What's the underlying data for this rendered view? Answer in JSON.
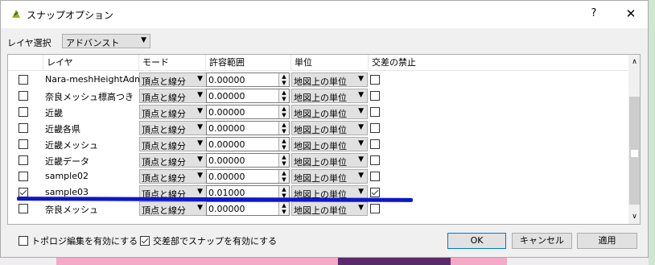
{
  "dialog": {
    "title": "スナップオプション",
    "help": "?",
    "close": "✕"
  },
  "layer_select": {
    "label": "レイヤ選択",
    "value": "アドバンスト"
  },
  "table": {
    "headers": [
      "レイヤ",
      "モード",
      "許容範囲",
      "単位",
      "交差の禁止"
    ],
    "rows": [
      {
        "checked": false,
        "name": "Nara-meshHeightAdm",
        "mode": "頂点と線分",
        "tolerance": "0.00000",
        "unit": "地図上の単位",
        "avoid": false
      },
      {
        "checked": false,
        "name": "奈良メッシュ標高つき",
        "mode": "頂点と線分",
        "tolerance": "0.00000",
        "unit": "地図上の単位",
        "avoid": false
      },
      {
        "checked": false,
        "name": "近畿",
        "mode": "頂点と線分",
        "tolerance": "0.00000",
        "unit": "地図上の単位",
        "avoid": false
      },
      {
        "checked": false,
        "name": "近畿各県",
        "mode": "頂点と線分",
        "tolerance": "0.00000",
        "unit": "地図上の単位",
        "avoid": false
      },
      {
        "checked": false,
        "name": "近畿メッシュ",
        "mode": "頂点と線分",
        "tolerance": "0.00000",
        "unit": "地図上の単位",
        "avoid": false
      },
      {
        "checked": false,
        "name": "近畿データ",
        "mode": "頂点と線分",
        "tolerance": "0.00000",
        "unit": "地図上の単位",
        "avoid": false
      },
      {
        "checked": false,
        "name": "sample02",
        "mode": "頂点と線分",
        "tolerance": "0.00000",
        "unit": "地図上の単位",
        "avoid": false
      },
      {
        "checked": true,
        "name": "sample03",
        "mode": "頂点と線分",
        "tolerance": "0.01000",
        "unit": "地図上の単位",
        "avoid": true
      },
      {
        "checked": false,
        "name": "奈良メッシュ",
        "mode": "頂点と線分",
        "tolerance": "0.00000",
        "unit": "地図上の単位",
        "avoid": false
      }
    ]
  },
  "footer": {
    "topology_label": "トポロジ編集を有効にする",
    "topology_checked": false,
    "intersection_label": "交差部でスナップを有効にする",
    "intersection_checked": true,
    "ok": "OK",
    "cancel": "キャンセル",
    "apply": "適用"
  },
  "colors": {
    "highlight_line": "#0f17c8"
  }
}
